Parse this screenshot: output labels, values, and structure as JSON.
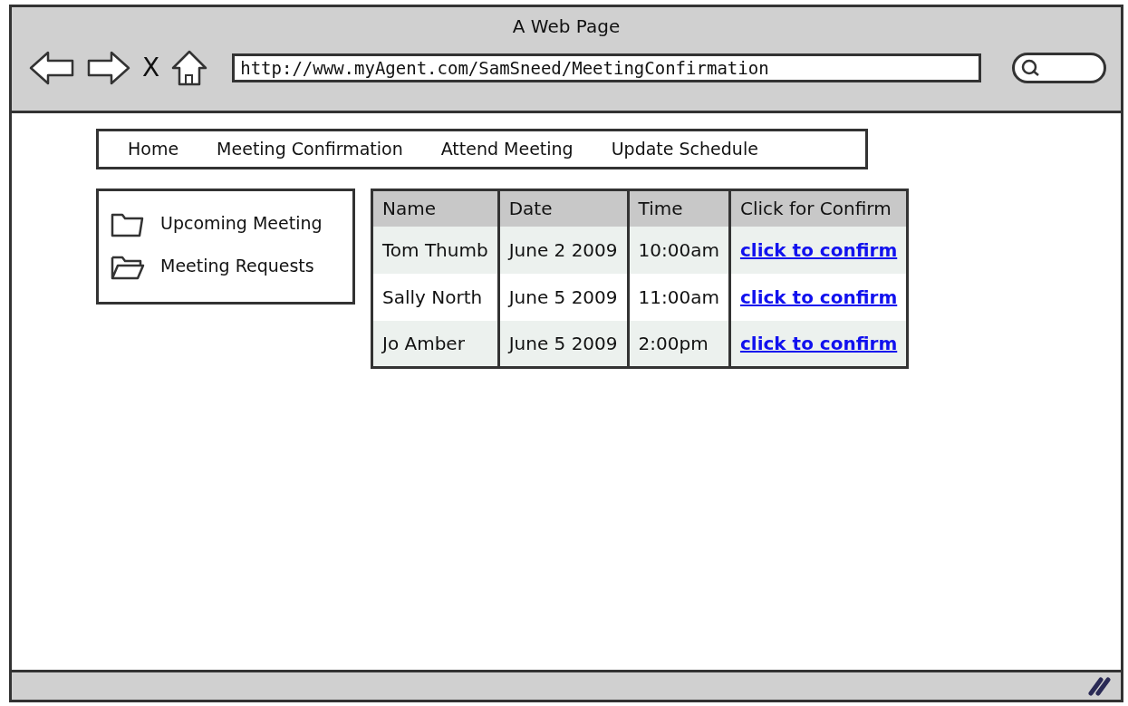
{
  "window": {
    "title": "A Web Page"
  },
  "toolbar": {
    "url": "http://www.myAgent.com/SamSneed/MeetingConfirmation",
    "stop_label": "X"
  },
  "menu": [
    "Home",
    "Meeting Confirmation",
    "Attend Meeting",
    "Update Schedule"
  ],
  "sidebar": {
    "items": [
      {
        "label": "Upcoming Meeting",
        "kind": "closed"
      },
      {
        "label": "Meeting Requests",
        "kind": "open"
      }
    ]
  },
  "table": {
    "columns": [
      "Name",
      "Date",
      "Time",
      "Click for Confirm"
    ],
    "rows": [
      [
        "Tom Thumb",
        "June 2 2009",
        "10:00am",
        "click to confirm"
      ],
      [
        "Sally North",
        "June 5 2009",
        "11:00am",
        "click to confirm"
      ],
      [
        "Jo Amber",
        "June 5 2009",
        "2:00pm",
        "click to confirm"
      ]
    ]
  }
}
